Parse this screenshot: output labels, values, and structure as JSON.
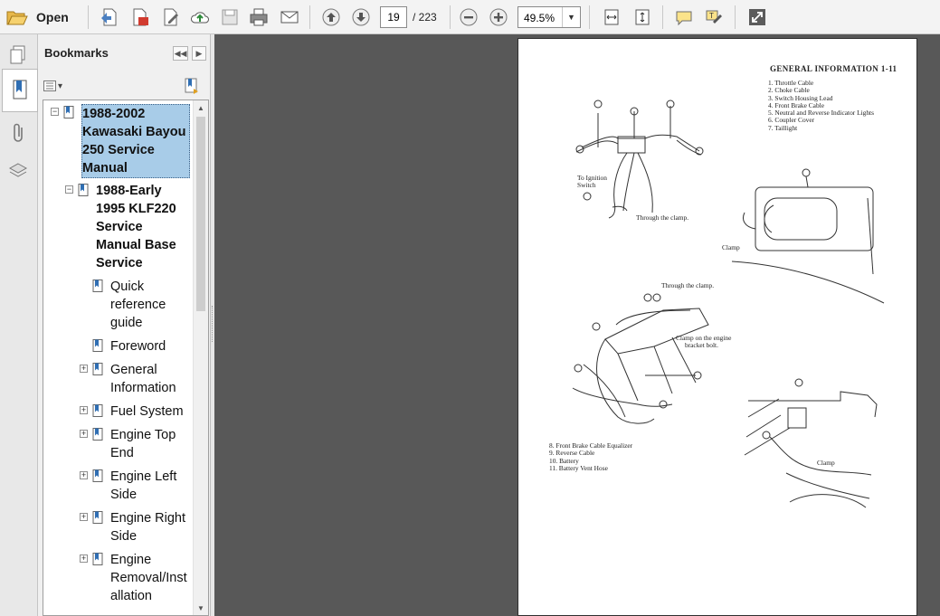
{
  "toolbar": {
    "open_label": "Open",
    "current_page": "19",
    "total_pages": "/ 223",
    "zoom": "49.5%"
  },
  "bookmarks_panel": {
    "title": "Bookmarks",
    "items": [
      {
        "label_lines": [
          "1988-2002",
          "Kawasaki Bayou",
          "250 Service",
          "Manual"
        ],
        "bold": true,
        "selected": true,
        "expander": "minus"
      },
      {
        "label_lines": [
          "1988-Early",
          "1995  KLF220",
          "Service",
          "Manual Base",
          "Service"
        ],
        "bold": true,
        "expander": "minus"
      },
      {
        "label_lines": [
          "Quick",
          "reference",
          "guide"
        ]
      },
      {
        "label_lines": [
          "Foreword"
        ]
      },
      {
        "label_lines": [
          "General",
          "Information"
        ],
        "expander": "plus"
      },
      {
        "label_lines": [
          "Fuel System"
        ],
        "expander": "plus"
      },
      {
        "label_lines": [
          "Engine Top",
          "End"
        ],
        "expander": "plus"
      },
      {
        "label_lines": [
          "Engine Left",
          "Side"
        ],
        "expander": "plus"
      },
      {
        "label_lines": [
          "Engine Right",
          "Side"
        ],
        "expander": "plus"
      },
      {
        "label_lines": [
          "Engine",
          "Removal/Inst",
          "allation"
        ],
        "expander": "plus"
      }
    ]
  },
  "document": {
    "header": "GENERAL  INFORMATION  1-11",
    "legend_top": [
      "1.  Throttle Cable",
      "2.  Choke Cable",
      "3.  Switch Housing Lead",
      "4.  Front Brake Cable",
      "5.  Neutral and Reverse Indicator Lights",
      "6.  Coupler Cover",
      "7.  Taillight"
    ],
    "legend_bottom": [
      "8.  Front Brake Cable Equalizer",
      "9.  Reverse Cable",
      "10.  Battery",
      "11.  Battery Vent Hose"
    ],
    "labels": {
      "to_ignition": "To Ignition",
      "switch": "Switch",
      "through_clamp_1": "Through the clamp.",
      "clamp_1": "Clamp",
      "through_clamp_2": "Through the clamp.",
      "clamp_engine_1": "Clamp on the engine",
      "clamp_engine_2": "bracket bolt.",
      "clamp_2": "Clamp"
    }
  }
}
